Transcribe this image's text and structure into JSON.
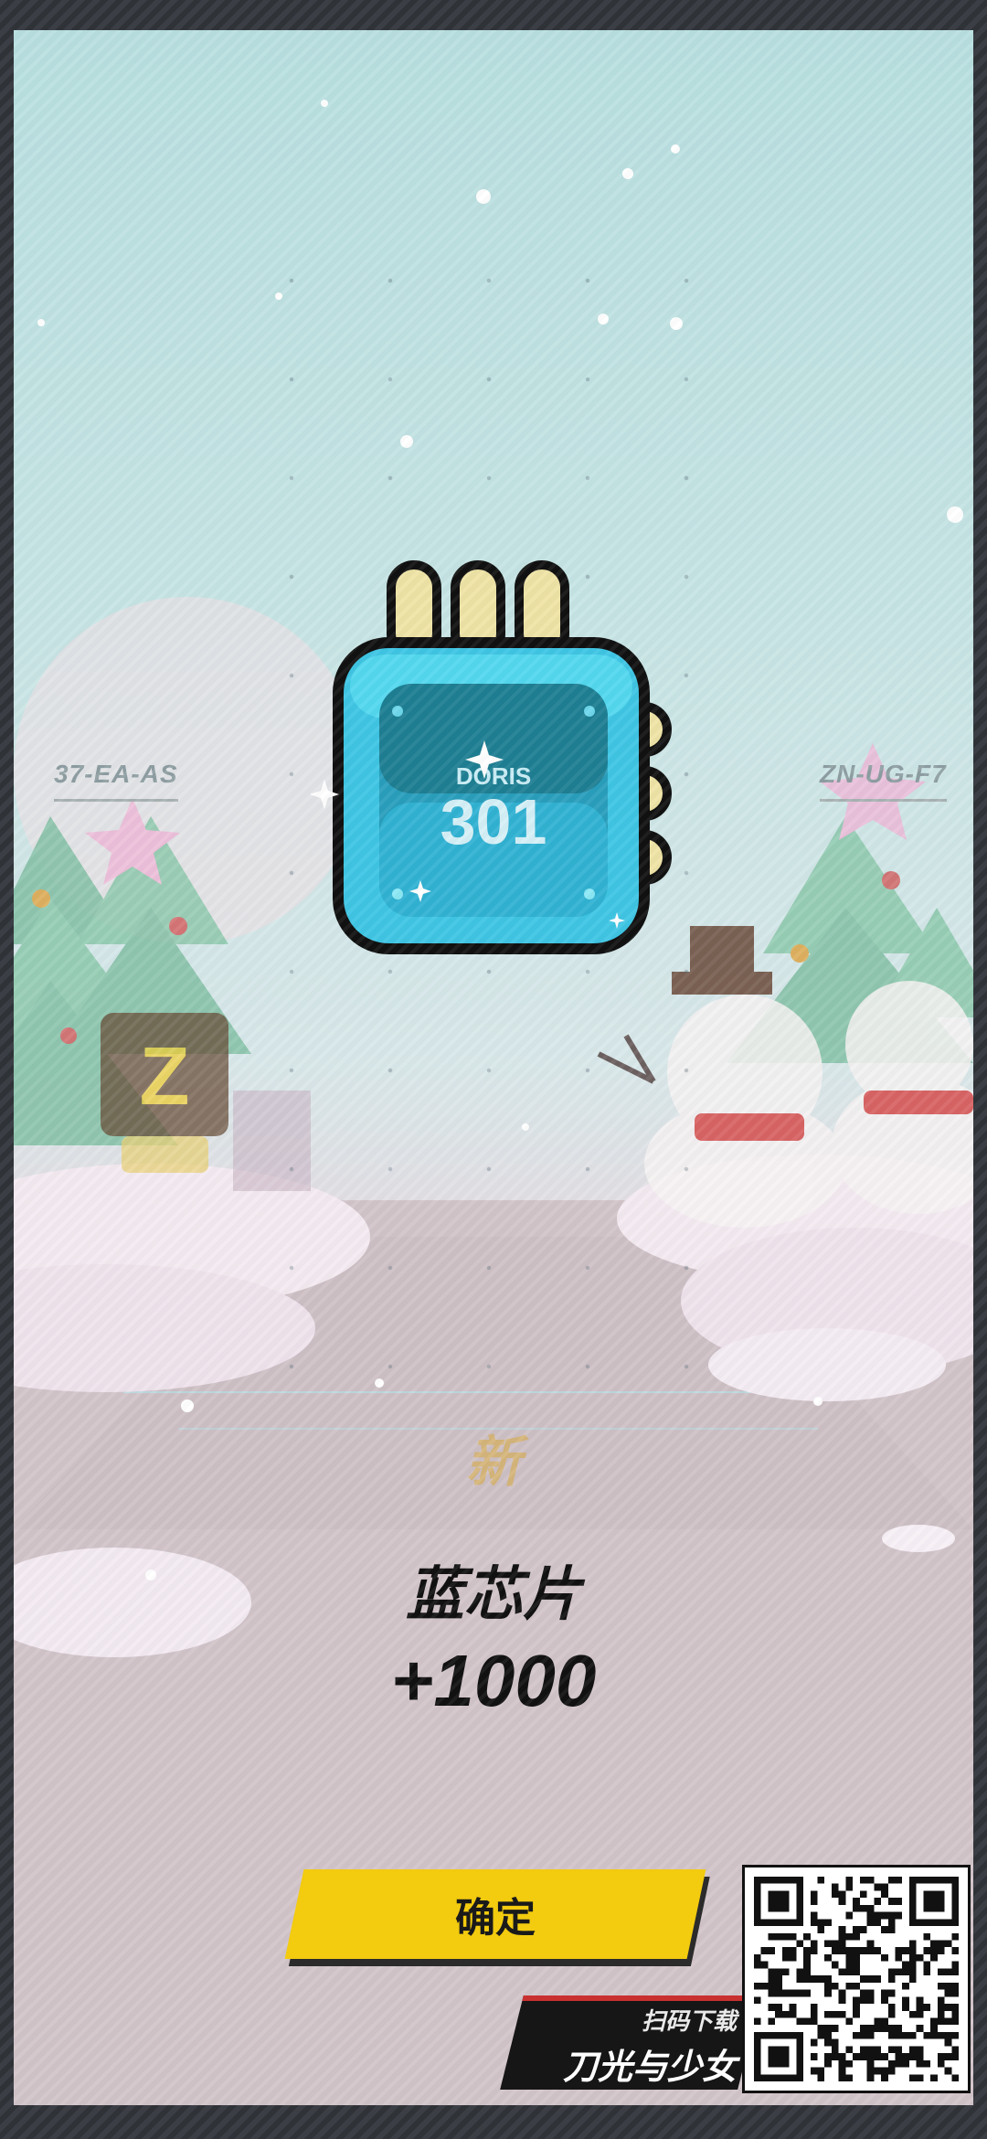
{
  "game": {
    "left_marker": "37-EA-AS",
    "right_marker": "ZN-UG-F7"
  },
  "reward": {
    "icon": "blue-chip-icon",
    "chip_brand": "DORIS",
    "chip_number": "301",
    "new_tag": "新",
    "name": "蓝芯片",
    "amount": "+1000"
  },
  "actions": {
    "confirm_label": "确定"
  },
  "promo": {
    "scan_text": "扫码下载",
    "game_title": "刀光与少女",
    "qr_icon": "qr-code-icon"
  },
  "colors": {
    "confirm_bg": "#f3cb0f",
    "chip_cyan": "#3fc6e4",
    "chip_dark": "#1f7f93",
    "pin_cream": "#efe3a6",
    "banner_red": "#c93030"
  }
}
